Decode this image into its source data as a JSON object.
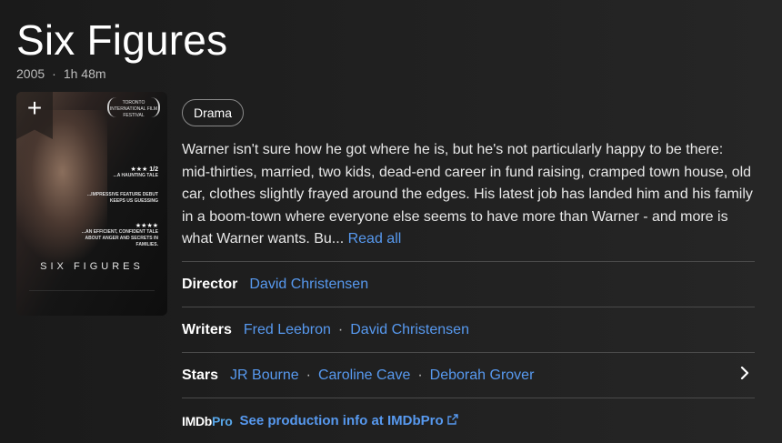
{
  "title": "Six Figures",
  "meta": {
    "year": "2005",
    "separator": "·",
    "runtime": "1h 48m"
  },
  "poster": {
    "add_symbol": "+",
    "festival": "TORONTO INTERNATIONAL FILM FESTIVAL",
    "quotes": [
      {
        "stars": "★★★ 1/2",
        "text": "...A HAUNTING TALE"
      },
      {
        "stars": "",
        "text": "...IMPRESSIVE FEATURE DEBUT KEEPS US GUESSING"
      },
      {
        "stars": "★★★★",
        "text": "...AN EFFICIENT, CONFIDENT TALE ABOUT ANGER AND SECRETS IN FAMILIES."
      }
    ],
    "title": "SIX FIGURES"
  },
  "genre": "Drama",
  "plot": {
    "text": "Warner isn't sure how he got where he is, but he's not particularly happy to be there: mid-thirties, married, two kids, dead-end career in fund raising, cramped town house, old car, clothes slightly frayed around the edges. His latest job has landed him and his family in a boom-town where everyone else seems to have more than Warner - and more is what Warner wants. Bu...",
    "read_all": "Read all"
  },
  "director": {
    "label": "Director",
    "names": [
      "David Christensen"
    ]
  },
  "writers": {
    "label": "Writers",
    "names": [
      "Fred Leebron",
      "David Christensen"
    ]
  },
  "stars": {
    "label": "Stars",
    "names": [
      "JR Bourne",
      "Caroline Cave",
      "Deborah Grover"
    ]
  },
  "separator": "·",
  "imdbpro": {
    "logo_a": "IMDb",
    "logo_b": "Pro",
    "link": "See production info at IMDbPro"
  },
  "colors": {
    "link": "#5799ef",
    "background": "#1f1f1f",
    "divider": "#4a4a4a"
  }
}
